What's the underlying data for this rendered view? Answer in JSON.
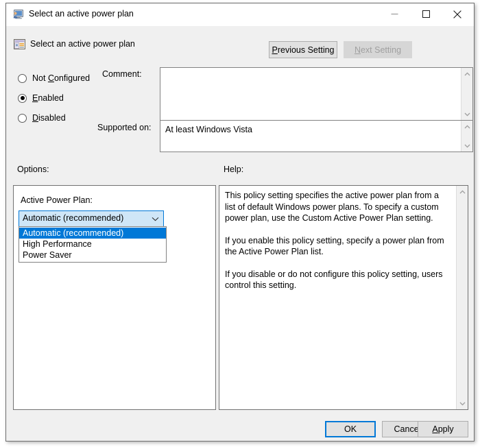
{
  "window": {
    "title": "Select an active power plan",
    "title_icon": "computer-user-icon",
    "minimize_label": "Minimize",
    "maximize_label": "Maximize",
    "close_label": "Close"
  },
  "header": {
    "title": "Select an active power plan",
    "icon": "policy-setting-icon",
    "previous_setting": "Previous Setting",
    "previous_accel": "P",
    "next_setting": "Next Setting",
    "next_accel": "N",
    "next_disabled": true
  },
  "state": {
    "options": [
      {
        "label": "Not Configured",
        "accel": "C",
        "checked": false
      },
      {
        "label": "Enabled",
        "accel": "E",
        "checked": true
      },
      {
        "label": "Disabled",
        "accel": "D",
        "checked": false
      }
    ]
  },
  "comment": {
    "label": "Comment:",
    "value": ""
  },
  "supported": {
    "label": "Supported on:",
    "value": "At least Windows Vista"
  },
  "options_panel": {
    "label": "Options:",
    "setting_label": "Active Power Plan:",
    "combo": {
      "value": "Automatic (recommended)",
      "expanded": true,
      "arrow_icon": "chevron-down-icon",
      "items": [
        "Automatic (recommended)",
        "High Performance",
        "Power Saver"
      ],
      "selected_index": 0
    }
  },
  "help_panel": {
    "label": "Help:",
    "paragraphs": [
      "This policy setting specifies the active power plan from a list of default Windows power plans. To specify a custom power plan, use the Custom Active Power Plan setting.",
      "If you enable this policy setting, specify a power plan from the Active Power Plan list.",
      "If you disable or do not configure this policy setting, users control this setting."
    ]
  },
  "footer": {
    "ok": "OK",
    "cancel": "Cancel",
    "apply": "Apply",
    "apply_accel": "A"
  },
  "colors": {
    "accent": "#0078d7",
    "dialog_bg": "#f0f0f0",
    "highlight_text": "#ffffff",
    "combo_bg": "#cfe6f7"
  }
}
